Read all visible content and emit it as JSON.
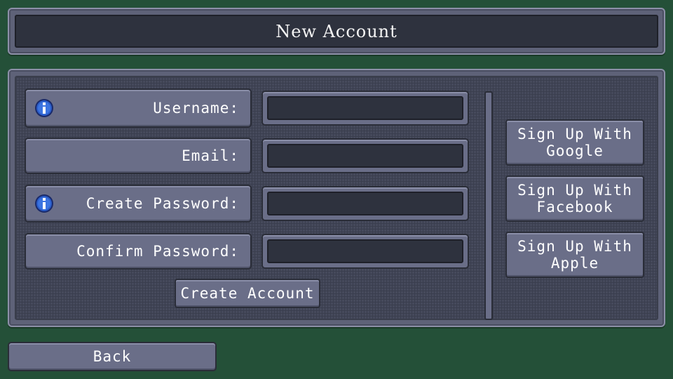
{
  "title": "New Account",
  "form": {
    "username_label": "Username:",
    "email_label": "Email:",
    "create_password_label": "Create Password:",
    "confirm_password_label": "Confirm Password:",
    "username_value": "",
    "email_value": "",
    "create_password_value": "",
    "confirm_password_value": "",
    "create_account_label": "Create Account"
  },
  "social": {
    "google": [
      "Sign Up With",
      "Google"
    ],
    "facebook": [
      "Sign Up With",
      "Facebook"
    ],
    "apple": [
      "Sign Up With",
      "Apple"
    ]
  },
  "back_label": "Back",
  "icons": {
    "info": "info-icon"
  },
  "colors": {
    "background": "#245038",
    "panel": "#5e6278",
    "field": "#2e323e",
    "button": "#6a6e88",
    "info_icon": "#2a5cc8"
  }
}
